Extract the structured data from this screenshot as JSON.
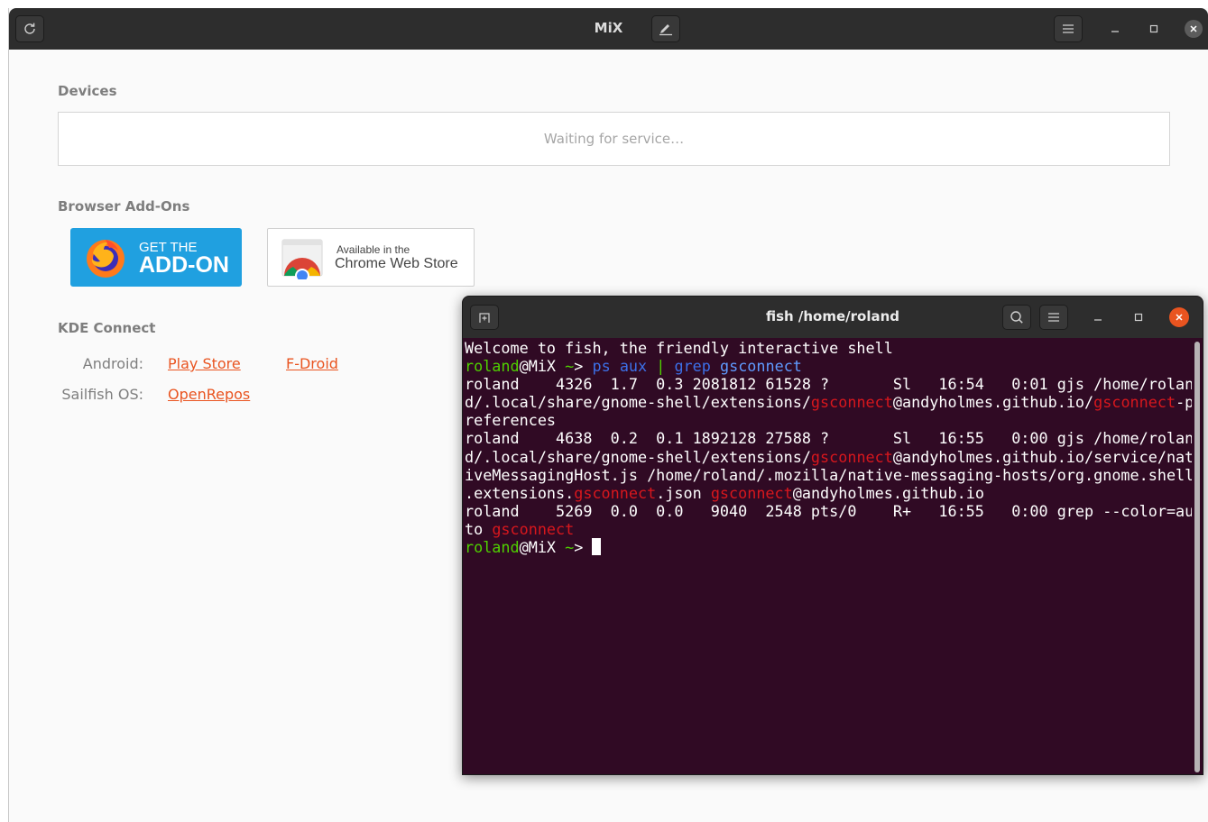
{
  "app": {
    "title": "MiX",
    "devices_label": "Devices",
    "devices_status": "Waiting for service…",
    "addons_label": "Browser Add-Ons",
    "firefox_badge": {
      "line1": "GET THE",
      "line2": "ADD-ON"
    },
    "chrome_badge": {
      "line1": "Available in the",
      "line2": "Chrome Web Store"
    },
    "kde_label": "KDE Connect",
    "kde_rows": [
      {
        "platform": "Android:",
        "links": [
          "Play Store",
          "F-Droid"
        ]
      },
      {
        "platform": "Sailfish OS:",
        "links": [
          "OpenRepos"
        ]
      }
    ]
  },
  "terminal": {
    "title": "fish /home/roland",
    "lines": [
      "Welcome to fish, the friendly interactive shell",
      "roland@MiX ~> ps aux | grep gsconnect",
      "roland    4326  1.7  0.3 2081812 61528 ?       Sl   16:54   0:01 gjs /home/rolan",
      "d/.local/share/gnome-shell/extensions/gsconnect@andyholmes.github.io/gsconnect-p",
      "references",
      "roland    4638  0.2  0.1 1892128 27588 ?       Sl   16:55   0:00 gjs /home/rolan",
      "d/.local/share/gnome-shell/extensions/gsconnect@andyholmes.github.io/service/nat",
      "iveMessagingHost.js /home/roland/.mozilla/native-messaging-hosts/org.gnome.shell",
      ".extensions.gsconnect.json gsconnect@andyholmes.github.io",
      "roland    5269  0.0  0.0   9040  2548 pts/0    R+   16:55   0:00 grep --color=au",
      "to gsconnect",
      "roland@MiX ~> "
    ]
  },
  "colors": {
    "accent_link": "#e95420",
    "terminal_bg": "#300a24",
    "prompt_user": "#4fd000",
    "command": "#3c70e8",
    "match_highlight": "#d8171d",
    "firefox_badge_bg": "#20a0e0"
  },
  "icons": {
    "refresh": "refresh-icon",
    "edit": "edit-icon",
    "menu": "hamburger-menu-icon",
    "new_tab": "new-tab-icon",
    "search": "search-icon",
    "minimize": "minimize-icon",
    "maximize": "maximize-icon",
    "close": "close-icon",
    "firefox": "firefox-logo-icon",
    "chrome": "chrome-logo-icon"
  }
}
